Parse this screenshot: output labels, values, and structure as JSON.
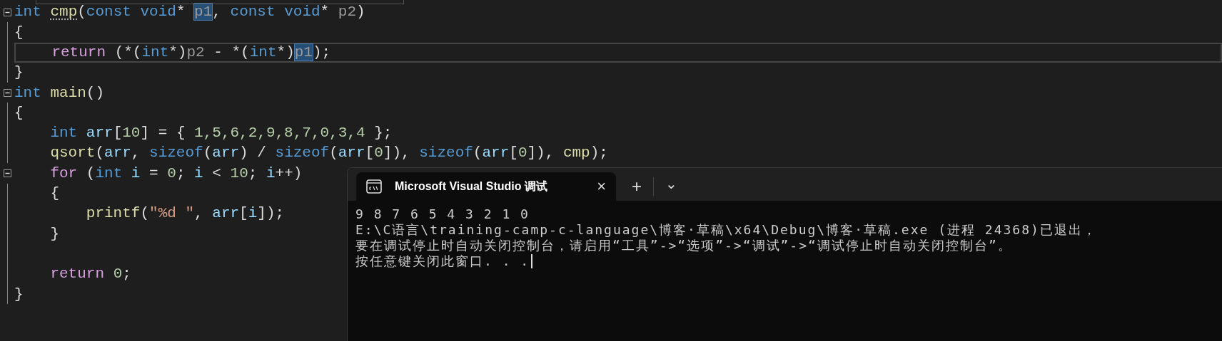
{
  "editor": {
    "lines": [
      {
        "collapsible": true,
        "current": false,
        "tokens": [
          {
            "text": "int ",
            "kind": "keyword"
          },
          {
            "text": "cmp",
            "kind": "function",
            "hint": true
          },
          {
            "text": "(",
            "kind": "plain"
          },
          {
            "text": "const ",
            "kind": "keyword"
          },
          {
            "text": "void",
            "kind": "keyword"
          },
          {
            "text": "* ",
            "kind": "plain"
          },
          {
            "text": "p1",
            "kind": "param",
            "highlighted": true
          },
          {
            "text": ", ",
            "kind": "plain"
          },
          {
            "text": "const ",
            "kind": "keyword"
          },
          {
            "text": "void",
            "kind": "keyword"
          },
          {
            "text": "* ",
            "kind": "plain"
          },
          {
            "text": "p2",
            "kind": "param"
          },
          {
            "text": ")",
            "kind": "plain"
          }
        ]
      },
      {
        "collapsible": false,
        "current": false,
        "tokens": [
          {
            "text": "{",
            "kind": "plain"
          }
        ]
      },
      {
        "collapsible": false,
        "current": true,
        "tokens": [
          {
            "text": "    return",
            "kind": "control"
          },
          {
            "text": " (*(",
            "kind": "plain"
          },
          {
            "text": "int",
            "kind": "keyword"
          },
          {
            "text": "*)",
            "kind": "plain"
          },
          {
            "text": "p2",
            "kind": "param"
          },
          {
            "text": " - *(",
            "kind": "plain"
          },
          {
            "text": "int",
            "kind": "keyword"
          },
          {
            "text": "*)",
            "kind": "plain"
          },
          {
            "text": "p1",
            "kind": "param",
            "highlighted": true
          },
          {
            "text": ");",
            "kind": "plain"
          }
        ]
      },
      {
        "collapsible": false,
        "current": false,
        "tokens": [
          {
            "text": "}",
            "kind": "plain"
          }
        ]
      },
      {
        "collapsible": true,
        "current": false,
        "tokens": [
          {
            "text": "int ",
            "kind": "keyword"
          },
          {
            "text": "main",
            "kind": "function"
          },
          {
            "text": "()",
            "kind": "plain"
          }
        ]
      },
      {
        "collapsible": false,
        "current": false,
        "tokens": [
          {
            "text": "{",
            "kind": "plain"
          }
        ]
      },
      {
        "collapsible": false,
        "current": false,
        "tokens": [
          {
            "text": "    int ",
            "kind": "keyword"
          },
          {
            "text": "arr",
            "kind": "variable"
          },
          {
            "text": "[",
            "kind": "plain"
          },
          {
            "text": "10",
            "kind": "number"
          },
          {
            "text": "] = { ",
            "kind": "plain"
          },
          {
            "text": "1,5,6,2,9,8,7,0,3,4",
            "kind": "number"
          },
          {
            "text": " };",
            "kind": "plain"
          }
        ]
      },
      {
        "collapsible": false,
        "current": false,
        "tokens": [
          {
            "text": "    qsort",
            "kind": "function"
          },
          {
            "text": "(",
            "kind": "plain"
          },
          {
            "text": "arr",
            "kind": "variable"
          },
          {
            "text": ", ",
            "kind": "plain"
          },
          {
            "text": "sizeof",
            "kind": "keyword"
          },
          {
            "text": "(",
            "kind": "plain"
          },
          {
            "text": "arr",
            "kind": "variable"
          },
          {
            "text": ") / ",
            "kind": "plain"
          },
          {
            "text": "sizeof",
            "kind": "keyword"
          },
          {
            "text": "(",
            "kind": "plain"
          },
          {
            "text": "arr",
            "kind": "variable"
          },
          {
            "text": "[",
            "kind": "plain"
          },
          {
            "text": "0",
            "kind": "number"
          },
          {
            "text": "]), ",
            "kind": "plain"
          },
          {
            "text": "sizeof",
            "kind": "keyword"
          },
          {
            "text": "(",
            "kind": "plain"
          },
          {
            "text": "arr",
            "kind": "variable"
          },
          {
            "text": "[",
            "kind": "plain"
          },
          {
            "text": "0",
            "kind": "number"
          },
          {
            "text": "]), ",
            "kind": "plain"
          },
          {
            "text": "cmp",
            "kind": "function"
          },
          {
            "text": ");",
            "kind": "plain"
          }
        ]
      },
      {
        "collapsible": true,
        "current": false,
        "tokens": [
          {
            "text": "    for",
            "kind": "control"
          },
          {
            "text": " (",
            "kind": "plain"
          },
          {
            "text": "int ",
            "kind": "keyword"
          },
          {
            "text": "i",
            "kind": "variable"
          },
          {
            "text": " = ",
            "kind": "plain"
          },
          {
            "text": "0",
            "kind": "number"
          },
          {
            "text": "; ",
            "kind": "plain"
          },
          {
            "text": "i",
            "kind": "variable"
          },
          {
            "text": " < ",
            "kind": "plain"
          },
          {
            "text": "10",
            "kind": "number"
          },
          {
            "text": "; ",
            "kind": "plain"
          },
          {
            "text": "i",
            "kind": "variable"
          },
          {
            "text": "++)",
            "kind": "plain"
          }
        ]
      },
      {
        "collapsible": false,
        "current": false,
        "tokens": [
          {
            "text": "    {",
            "kind": "plain"
          }
        ]
      },
      {
        "collapsible": false,
        "current": false,
        "tokens": [
          {
            "text": "        printf",
            "kind": "function"
          },
          {
            "text": "(",
            "kind": "plain"
          },
          {
            "text": "\"%d \"",
            "kind": "string"
          },
          {
            "text": ", ",
            "kind": "plain"
          },
          {
            "text": "arr",
            "kind": "variable"
          },
          {
            "text": "[",
            "kind": "plain"
          },
          {
            "text": "i",
            "kind": "variable"
          },
          {
            "text": "]);",
            "kind": "plain"
          }
        ]
      },
      {
        "collapsible": false,
        "current": false,
        "tokens": [
          {
            "text": "    }",
            "kind": "plain"
          }
        ]
      },
      {
        "collapsible": false,
        "current": false
      },
      {
        "collapsible": false,
        "current": false,
        "tokens": [
          {
            "text": "    return ",
            "kind": "control"
          },
          {
            "text": "0",
            "kind": "number"
          },
          {
            "text": ";",
            "kind": "plain"
          }
        ]
      },
      {
        "collapsible": false,
        "current": false,
        "tokens": [
          {
            "text": "}",
            "kind": "plain"
          }
        ]
      }
    ]
  },
  "terminal": {
    "tab": {
      "title": "Microsoft Visual Studio 调试",
      "close": "×"
    },
    "new_tab": "+",
    "dropdown": "⌄",
    "output": [
      "9 8 7 6 5 4 3 2 1 0",
      "E:\\C语言\\training-camp-c-language\\博客·草稿\\x64\\Debug\\博客·草稿.exe (进程 24368)已退出，",
      "要在调试停止时自动关闭控制台，请启用“工具”->“选项”->“调试”->“调试停止时自动关闭控制台”。",
      "按任意键关闭此窗口. . ."
    ]
  }
}
